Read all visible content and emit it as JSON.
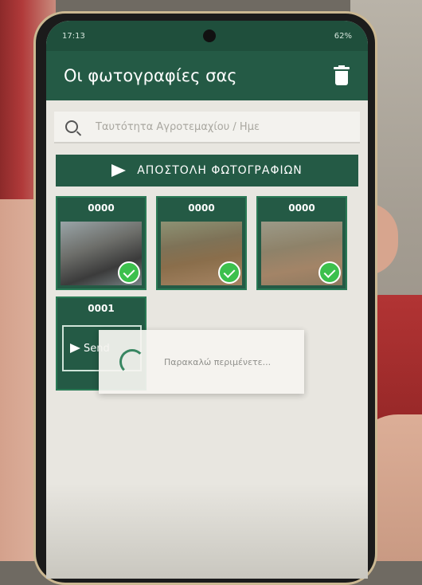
{
  "status_bar": {
    "time": "17:13",
    "right_text": "62%"
  },
  "app_bar": {
    "title": "Οι φωτογραφίες σας",
    "delete_icon": "trash-icon"
  },
  "search": {
    "placeholder": "Ταυτότητα Αγροτεμαχίου / Ημε",
    "icon": "search-icon"
  },
  "send_button": {
    "label": "ΑΠΟΣΤΟΛΗ ΦΩΤΟΓΡΑΦΙΩΝ"
  },
  "photos": [
    {
      "code": "0000",
      "uploaded": true
    },
    {
      "code": "0000",
      "uploaded": true
    },
    {
      "code": "0000",
      "uploaded": true
    },
    {
      "code": "0001",
      "uploaded": false,
      "action_label": "Send"
    }
  ],
  "loading_dialog": {
    "message": "Παρακαλώ περιμένετε..."
  },
  "colors": {
    "primary": "#245a45",
    "status_bar": "#1f4f3c",
    "check": "#3cc04d"
  }
}
